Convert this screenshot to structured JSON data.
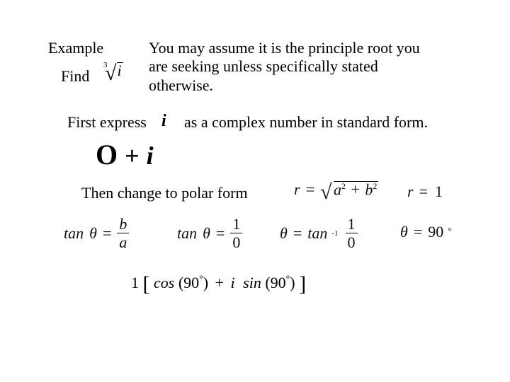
{
  "header": {
    "example_label": "Example",
    "find_label": "Find",
    "assume_text": "You may assume it is the principle root you are seeking unless specifically stated otherwise."
  },
  "radicand": {
    "index": "3",
    "body": "i"
  },
  "line_first_express": {
    "lead": "First express",
    "mid_symbol": "i",
    "tail": "as a complex number in standard form."
  },
  "std_form": {
    "zero": "O",
    "plus": "+",
    "i": "i"
  },
  "line_then": "Then change to polar form",
  "eq_r_def": {
    "r": "r",
    "eq": "=",
    "a2": "a",
    "b2": "b",
    "sq": "2",
    "plus": "+"
  },
  "eq_r_val": {
    "r": "r",
    "eq": "=",
    "one": "1"
  },
  "eq_tan_def": {
    "tan": "tan",
    "theta": "θ",
    "eq": "=",
    "b": "b",
    "a": "a"
  },
  "eq_tan_val": {
    "tan": "tan",
    "theta": "θ",
    "eq": "=",
    "one": "1",
    "zero": "0"
  },
  "eq_theta_def": {
    "theta": "θ",
    "eq": "=",
    "tan": "tan",
    "inv": "-1",
    "one": "1",
    "zero": "0"
  },
  "eq_theta_val": {
    "theta": "θ",
    "eq": "=",
    "ninety": "90",
    "deg": "°"
  },
  "polar": {
    "one": "1",
    "cos": "cos",
    "sin": "sin",
    "ang": "90",
    "deg": "°",
    "plus": "+",
    "i": "i"
  }
}
